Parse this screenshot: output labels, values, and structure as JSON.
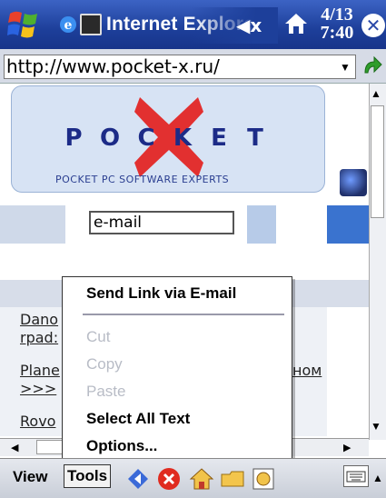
{
  "window": {
    "title": "Internet Explorer",
    "clock_line1": "4/13",
    "clock_line2": "7:40",
    "close_label": "✕",
    "speaker_symbol": "◀x"
  },
  "address": {
    "url": "http://www.pocket-x.ru/"
  },
  "page": {
    "logo_letters": [
      "P",
      "O",
      "C",
      "K",
      "E",
      "T"
    ],
    "tagline": "POCKET PC SOFTWARE EXPERTS",
    "email_field": "e-mail",
    "links": {
      "link1": "Dano",
      "link2": "rpad:",
      "link3": "Plane",
      "link4": ">>>",
      "link5": "Rovo",
      "link6": "ном"
    }
  },
  "context_menu": {
    "send_link": "Send Link via E-mail",
    "cut": "Cut",
    "copy": "Copy",
    "paste": "Paste",
    "select_all": "Select All Text",
    "options": "Options..."
  },
  "menubar": {
    "view": "View",
    "tools": "Tools"
  },
  "colors": {
    "titlebar": "#1d3f9a",
    "logo_blue": "#1c2b87",
    "logo_red": "#e23030",
    "disabled_text": "#b8bcc6"
  },
  "icons": {
    "start": "windows-flag-icon",
    "app": "ie-icon",
    "home": "home-icon",
    "go": "green-arrow-icon",
    "back": "back-icon",
    "stop": "stop-icon",
    "favorites": "favorites-icon",
    "history": "history-icon",
    "refresh": "refresh-icon",
    "keyboard": "keyboard-icon"
  }
}
